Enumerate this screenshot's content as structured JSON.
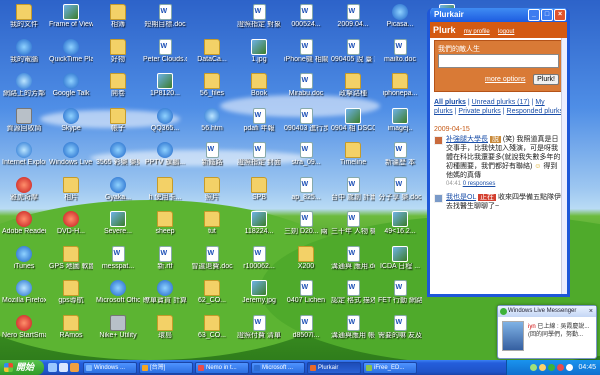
{
  "desktop": {
    "icons": [
      {
        "label": "我的文件",
        "icon": "folder",
        "col": 0,
        "row": 0
      },
      {
        "label": "我的電腦",
        "icon": "app",
        "col": 0,
        "row": 1
      },
      {
        "label": "網路上的芳鄰",
        "icon": "web",
        "col": 0,
        "row": 2
      },
      {
        "label": "資源回收筒",
        "icon": "gray",
        "col": 0,
        "row": 3
      },
      {
        "label": "Internet Explorer",
        "icon": "web",
        "col": 0,
        "row": 4
      },
      {
        "label": "雅虎奇摩",
        "icon": "red",
        "col": 0,
        "row": 5
      },
      {
        "label": "Adobe Reader 8",
        "icon": "red",
        "col": 0,
        "row": 6
      },
      {
        "label": "iTunes",
        "icon": "app",
        "col": 0,
        "row": 7
      },
      {
        "label": "Mozilla Firefox",
        "icon": "web",
        "col": 0,
        "row": 8
      },
      {
        "label": "Nero StartSmart",
        "icon": "red",
        "col": 0,
        "row": 9
      },
      {
        "label": "Frame of View",
        "icon": "img",
        "col": 1,
        "row": 0
      },
      {
        "label": "QuickTime Player",
        "icon": "app",
        "col": 1,
        "row": 1
      },
      {
        "label": "Google Talk",
        "icon": "app",
        "col": 1,
        "row": 2
      },
      {
        "label": "Skype",
        "icon": "app",
        "col": 1,
        "row": 3
      },
      {
        "label": "Windows Live Me...",
        "icon": "app",
        "col": 1,
        "row": 4
      },
      {
        "label": "相片",
        "icon": "folder",
        "col": 1,
        "row": 5
      },
      {
        "label": "DVD-H...",
        "icon": "red",
        "col": 1,
        "row": 6
      },
      {
        "label": "GPS 地圖 軟體",
        "icon": "folder",
        "col": 1,
        "row": 7
      },
      {
        "label": "gps導航",
        "icon": "folder",
        "col": 1,
        "row": 8
      },
      {
        "label": "RAmos",
        "icon": "folder",
        "col": 1,
        "row": 9
      },
      {
        "label": "相簿",
        "icon": "folder",
        "col": 2,
        "row": 0
      },
      {
        "label": "好物",
        "icon": "folder",
        "col": 2,
        "row": 1
      },
      {
        "label": "開卷",
        "icon": "folder",
        "col": 2,
        "row": 2
      },
      {
        "label": "帳子",
        "icon": "folder",
        "col": 2,
        "row": 3
      },
      {
        "label": "3565 彩樂 樂樂 軟體",
        "icon": "app",
        "col": 2,
        "row": 4
      },
      {
        "label": "Gyaka...",
        "icon": "app",
        "col": 2,
        "row": 5
      },
      {
        "label": "Severe...",
        "icon": "img",
        "col": 2,
        "row": 6
      },
      {
        "label": "messpat...",
        "icon": "doc",
        "col": 2,
        "row": 7
      },
      {
        "label": "Microsoft Office ...",
        "icon": "app",
        "col": 2,
        "row": 8
      },
      {
        "label": "Nike+ Utility",
        "icon": "gray",
        "col": 2,
        "row": 9
      },
      {
        "label": "短期目標.doc",
        "icon": "doc",
        "col": 3,
        "row": 0
      },
      {
        "label": "Peter Clouds.doc",
        "icon": "doc",
        "col": 3,
        "row": 1
      },
      {
        "label": "1P8120...",
        "icon": "img",
        "col": 3,
        "row": 2
      },
      {
        "label": "QQ365...",
        "icon": "app",
        "col": 3,
        "row": 3
      },
      {
        "label": "PPTV 旗鵬...",
        "icon": "app",
        "col": 3,
        "row": 4
      },
      {
        "label": "h 使用卡...",
        "icon": "folder",
        "col": 3,
        "row": 5
      },
      {
        "label": "sheep",
        "icon": "folder",
        "col": 3,
        "row": 6
      },
      {
        "label": "新.rtf",
        "icon": "doc",
        "col": 3,
        "row": 7
      },
      {
        "label": "瞭單寶貨 計算機",
        "icon": "app",
        "col": 3,
        "row": 8
      },
      {
        "label": "環島",
        "icon": "folder",
        "col": 3,
        "row": 9
      },
      {
        "label": "DataCa...",
        "icon": "folder",
        "col": 4,
        "row": 1
      },
      {
        "label": "56_files",
        "icon": "folder",
        "col": 4,
        "row": 2
      },
      {
        "label": "56.htm",
        "icon": "web",
        "col": 4,
        "row": 3
      },
      {
        "label": "新鐵路",
        "icon": "doc",
        "col": 4,
        "row": 4
      },
      {
        "label": "照片",
        "icon": "folder",
        "col": 4,
        "row": 5
      },
      {
        "label": "tut",
        "icon": "folder",
        "col": 4,
        "row": 6
      },
      {
        "label": "曾違退費.doc",
        "icon": "doc",
        "col": 4,
        "row": 7
      },
      {
        "label": "62_CO...",
        "icon": "folder",
        "col": 4,
        "row": 8
      },
      {
        "label": "63_CO...",
        "icon": "folder",
        "col": 4,
        "row": 9
      },
      {
        "label": "證照指定 對象.doc",
        "icon": "doc",
        "col": 5,
        "row": 0
      },
      {
        "label": "1.jpg",
        "icon": "img",
        "col": 5,
        "row": 1
      },
      {
        "label": "Book",
        "icon": "folder",
        "col": 5,
        "row": 2
      },
      {
        "label": "pdafi 年報",
        "icon": "doc",
        "col": 5,
        "row": 3
      },
      {
        "label": "證照指定 封面",
        "icon": "doc",
        "col": 5,
        "row": 4
      },
      {
        "label": "SPB",
        "icon": "folder",
        "col": 5,
        "row": 5
      },
      {
        "label": "118224...",
        "icon": "img",
        "col": 5,
        "row": 6
      },
      {
        "label": "r100062...",
        "icon": "doc",
        "col": 5,
        "row": 7
      },
      {
        "label": "Jeremy.jpg",
        "icon": "img",
        "col": 5,
        "row": 8
      },
      {
        "label": "證照付費 清單",
        "icon": "doc",
        "col": 5,
        "row": 9
      },
      {
        "label": "000524...",
        "icon": "doc",
        "col": 6,
        "row": 0
      },
      {
        "label": "iPhone機 相關.doc",
        "icon": "doc",
        "col": 6,
        "row": 1
      },
      {
        "label": "Mirabu.doc",
        "icon": "doc",
        "col": 6,
        "row": 2
      },
      {
        "label": "090403 進行步驟",
        "icon": "doc",
        "col": 6,
        "row": 3
      },
      {
        "label": "stra_09...",
        "icon": "doc",
        "col": 6,
        "row": 4
      },
      {
        "label": "ap_825...",
        "icon": "doc",
        "col": 6,
        "row": 5
      },
      {
        "label": "三劍 D20... 兩劍",
        "icon": "doc",
        "col": 6,
        "row": 6
      },
      {
        "label": "X200",
        "icon": "folder",
        "col": 6,
        "row": 7
      },
      {
        "label": "0407 Lichen",
        "icon": "doc",
        "col": 6,
        "row": 8
      },
      {
        "label": "d8507l...",
        "icon": "doc",
        "col": 6,
        "row": 9
      },
      {
        "label": "2009.04...",
        "icon": "doc",
        "col": 7,
        "row": 0
      },
      {
        "label": "090405 說 臺 說明",
        "icon": "doc",
        "col": 7,
        "row": 1
      },
      {
        "label": "政擊路種",
        "icon": "folder",
        "col": 7,
        "row": 2
      },
      {
        "label": "0904 相 DSC0...",
        "icon": "img",
        "col": 7,
        "row": 3
      },
      {
        "label": "Timeline",
        "icon": "folder",
        "col": 7,
        "row": 4
      },
      {
        "label": "台中 歲創 計畫.doc",
        "icon": "doc",
        "col": 7,
        "row": 5
      },
      {
        "label": "三十年 人物 機關.doc",
        "icon": "doc",
        "col": 7,
        "row": 6
      },
      {
        "label": "溝通與 應用.doc",
        "icon": "doc",
        "col": 7,
        "row": 7
      },
      {
        "label": "認定 格式 描述版",
        "icon": "doc",
        "col": 7,
        "row": 8
      },
      {
        "label": "溝通與應用 帳號.doc",
        "icon": "doc",
        "col": 7,
        "row": 9
      },
      {
        "label": "Picasa...",
        "icon": "app",
        "col": 8,
        "row": 0
      },
      {
        "label": "mailto.doc",
        "icon": "doc",
        "col": 8,
        "row": 1
      },
      {
        "label": "iphonepa...",
        "icon": "folder",
        "col": 8,
        "row": 2
      },
      {
        "label": "imagej..",
        "icon": "img",
        "col": 8,
        "row": 3
      },
      {
        "label": "新疆歷 本",
        "icon": "doc",
        "col": 8,
        "row": 4
      },
      {
        "label": "分子享 樂.doc",
        "icon": "doc",
        "col": 8,
        "row": 5
      },
      {
        "label": "49<16.2...",
        "icon": "img",
        "col": 8,
        "row": 6
      },
      {
        "label": "ICDA 日程 ...",
        "icon": "img",
        "col": 8,
        "row": 7
      },
      {
        "label": "FET 行動 網路",
        "icon": "doc",
        "col": 8,
        "row": 8
      },
      {
        "label": "需要的嘛 友及網.doc",
        "icon": "doc",
        "col": 8,
        "row": 9
      },
      {
        "label": "pluskurk",
        "icon": "img",
        "col": 9,
        "row": 0
      },
      {
        "label": "blakeu...",
        "icon": "red",
        "col": 9,
        "row": 1
      },
      {
        "label": "Ilgen_ED...",
        "icon": "img",
        "col": 9,
        "row": 2
      }
    ]
  },
  "plurk": {
    "window_title": "Plurkair",
    "logo": "Plurk",
    "my_profile": "my profile",
    "logout": "logout",
    "prompt": "我們的敵人生",
    "textarea_value": "",
    "more_options": "more options",
    "submit": "Plurk!",
    "filters": {
      "all": "All plurks",
      "unread": "Unread plurks (17)",
      "my": "My plurks",
      "private": "Private plurks",
      "responded": "Responded plurks"
    },
    "date": "2009-04-15",
    "posts": [
      {
        "who": "补強腿大學長",
        "tag": "說",
        "text": "(笑) 我照道真是日交事手，比我快加入殘演，可是呀我體在科比我還要多(就說我失數多年的初種團要，我們都好有聯絡)",
        "tail": "得到他媽的真傳",
        "time": "04:41",
        "responses": "0 responses"
      },
      {
        "who": "我也是OL",
        "tag": "正在",
        "text": "收來四學備五點隊伊去找醫生聊聊了~",
        "tail": "",
        "time": "",
        "responses": ""
      }
    ]
  },
  "messenger": {
    "title": "Windows Live Messenger",
    "name": "iyn",
    "status": "已上線",
    "message": ": 吳霞慶說...(回的同學們，努勤..."
  },
  "taskbar": {
    "start": "開始",
    "tasks": [
      {
        "label": "Windows ...",
        "color": "#7db7ff"
      },
      {
        "label": "[台灣]",
        "color": "#f6a623"
      },
      {
        "label": "Nemo in t...",
        "color": "#e84c4c"
      },
      {
        "label": "Microsoft ...",
        "color": "#2f6fd6"
      },
      {
        "label": "Plurkair",
        "color": "#e86a2a"
      },
      {
        "label": "iFree_ED...",
        "color": "#8bc34a"
      }
    ],
    "clock": "04:45"
  }
}
